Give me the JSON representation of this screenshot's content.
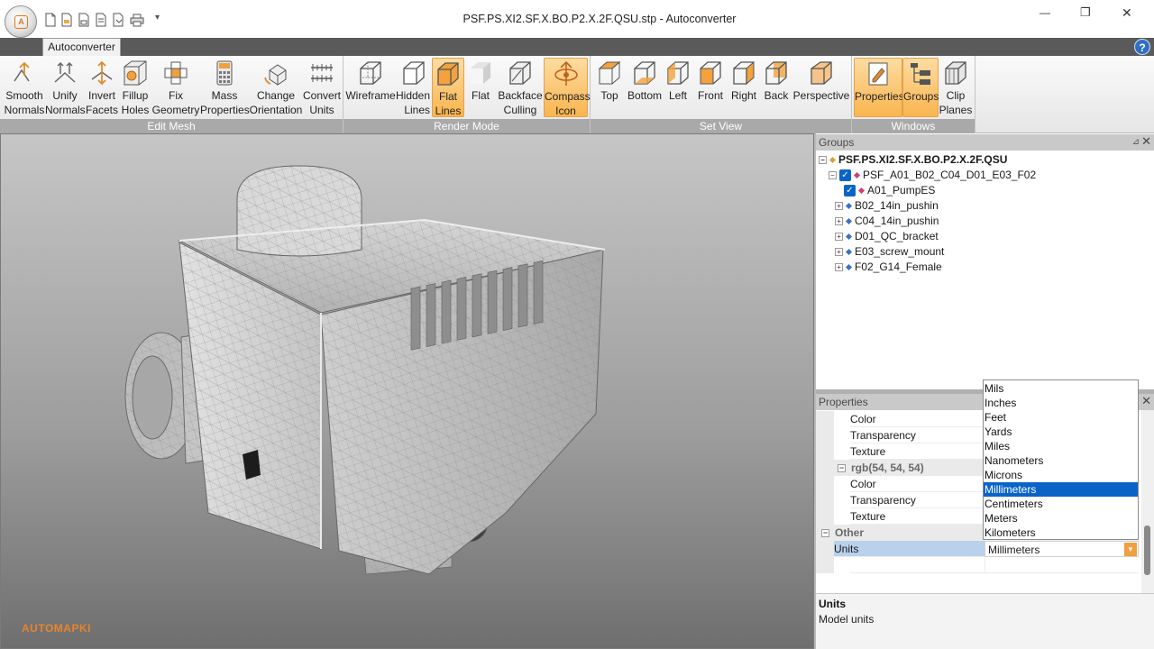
{
  "window": {
    "title": "PSF.PS.XI2.SF.X.BO.P2.X.2F.QSU.stp - Autoconverter",
    "app_orb_letter": "A",
    "minimize_glyph": "—",
    "maximize_glyph": "❐",
    "close_glyph": "✕",
    "qat_more_glyph": "▾"
  },
  "ribbon": {
    "tab": "Autoconverter",
    "help_glyph": "?",
    "groups": [
      {
        "label": "Edit Mesh",
        "buttons": [
          {
            "label": "Smooth\nNormals",
            "icon": "smooth-normals-icon"
          },
          {
            "label": "Unify\nNormals",
            "icon": "unify-normals-icon"
          },
          {
            "label": "Invert\nFacets",
            "icon": "invert-facets-icon"
          },
          {
            "label": "Fillup\nHoles",
            "icon": "fillup-holes-icon"
          },
          {
            "label": "Fix\nGeometry",
            "icon": "fix-geometry-icon"
          },
          {
            "label": "Mass\nProperties",
            "icon": "calculator-icon"
          },
          {
            "label": "Change\nOrientation",
            "icon": "change-orientation-icon"
          },
          {
            "label": "Convert\nUnits",
            "icon": "convert-units-icon"
          }
        ]
      },
      {
        "label": "Render Mode",
        "buttons": [
          {
            "label": "Wireframe",
            "icon": "wireframe-cube-icon"
          },
          {
            "label": "Hidden\nLines",
            "icon": "hidden-lines-cube-icon"
          },
          {
            "label": "Flat\nLines",
            "icon": "flat-lines-cube-icon",
            "active": true
          },
          {
            "label": "Flat",
            "icon": "flat-cube-icon"
          },
          {
            "label": "Backface\nCulling",
            "icon": "backface-culling-cube-icon"
          },
          {
            "label": "Compass\nIcon",
            "icon": "compass-icon",
            "active": true
          }
        ]
      },
      {
        "label": "Set View",
        "buttons": [
          {
            "label": "Top",
            "icon": "top-view-cube-icon"
          },
          {
            "label": "Bottom",
            "icon": "bottom-view-cube-icon"
          },
          {
            "label": "Left",
            "icon": "left-view-cube-icon"
          },
          {
            "label": "Front",
            "icon": "front-view-cube-icon"
          },
          {
            "label": "Right",
            "icon": "right-view-cube-icon"
          },
          {
            "label": "Back",
            "icon": "back-view-cube-icon"
          },
          {
            "label": "Perspective",
            "icon": "perspective-cube-icon"
          }
        ]
      },
      {
        "label": "Windows",
        "buttons": [
          {
            "label": "Properties",
            "icon": "properties-icon",
            "active": true
          },
          {
            "label": "Groups",
            "icon": "groups-tree-icon",
            "active": true
          },
          {
            "label": "Clip\nPlanes",
            "icon": "clip-planes-icon"
          }
        ]
      }
    ]
  },
  "viewport": {
    "watermark": "AUTOMAPKI"
  },
  "groups_pane": {
    "title": "Groups",
    "pin_glyph": "⊿",
    "close_glyph": "✕",
    "root": "PSF.PS.XI2.SF.X.BO.P2.X.2F.QSU",
    "child": "PSF_A01_B02_C04_D01_E03_F02",
    "parts": [
      "A01_PumpES",
      "B02_14in_pushin",
      "C04_14in_pushin",
      "D01_QC_bracket",
      "E03_screw_mount",
      "F02_G14_Female"
    ]
  },
  "properties_pane": {
    "title": "Properties",
    "close_glyph": "✕",
    "rows": [
      {
        "type": "prop",
        "name": "Color"
      },
      {
        "type": "prop",
        "name": "Transparency"
      },
      {
        "type": "prop",
        "name": "Texture"
      },
      {
        "type": "category",
        "name": "rgb(54, 54, 54)"
      },
      {
        "type": "prop",
        "name": "Color"
      },
      {
        "type": "prop",
        "name": "Transparency"
      },
      {
        "type": "prop",
        "name": "Texture"
      },
      {
        "type": "category",
        "name": "Other"
      }
    ],
    "units_label": "Units",
    "units_value": "Millimeters",
    "units_options": [
      "Mils",
      "Inches",
      "Feet",
      "Yards",
      "Miles",
      "Nanometers",
      "Microns",
      "Millimeters",
      "Centimeters",
      "Meters",
      "Kilometers"
    ],
    "selected_option": "Millimeters",
    "expander_glyph": "−",
    "dropdown_glyph": "▼",
    "description_title": "Units",
    "description_text": "Model units"
  },
  "colors": {
    "accent_orange": "#f9b54f",
    "selection_blue": "#0a64c8",
    "watermark": "#e8842a"
  }
}
